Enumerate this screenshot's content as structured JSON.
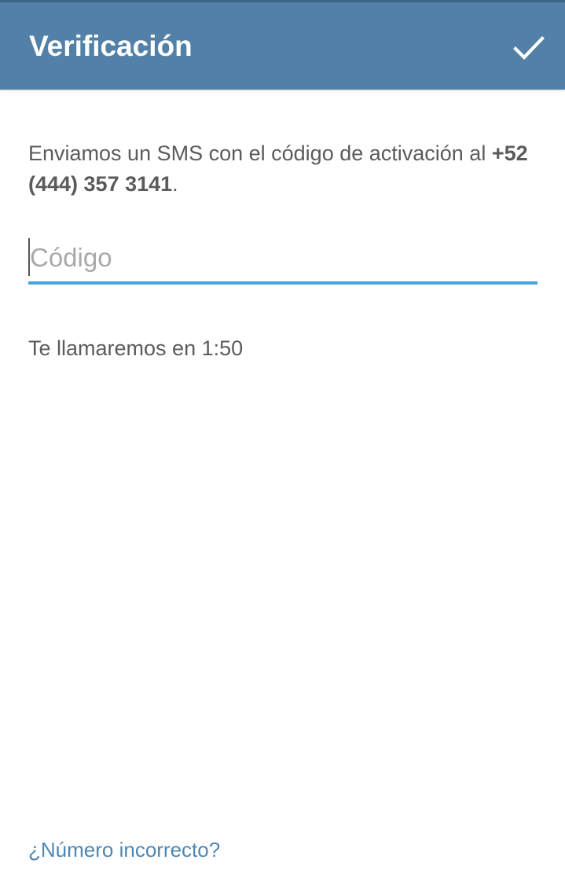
{
  "header": {
    "title": "Verificación",
    "done_icon": "checkmark-icon"
  },
  "message": {
    "text": "Enviamos un SMS con el código de activación al ",
    "phone": "+52 (444) 357 3141",
    "suffix": "."
  },
  "code_input": {
    "value": "",
    "placeholder": "Código"
  },
  "timer": {
    "text": "Te llamaremos en 1:50"
  },
  "footer": {
    "wrong_number_link": "¿Número incorrecto?"
  },
  "colors": {
    "app_bar": "#5280a6",
    "accent_underline": "#45a6d9",
    "link": "#4d87b3",
    "body_text": "#5b5b5b"
  }
}
